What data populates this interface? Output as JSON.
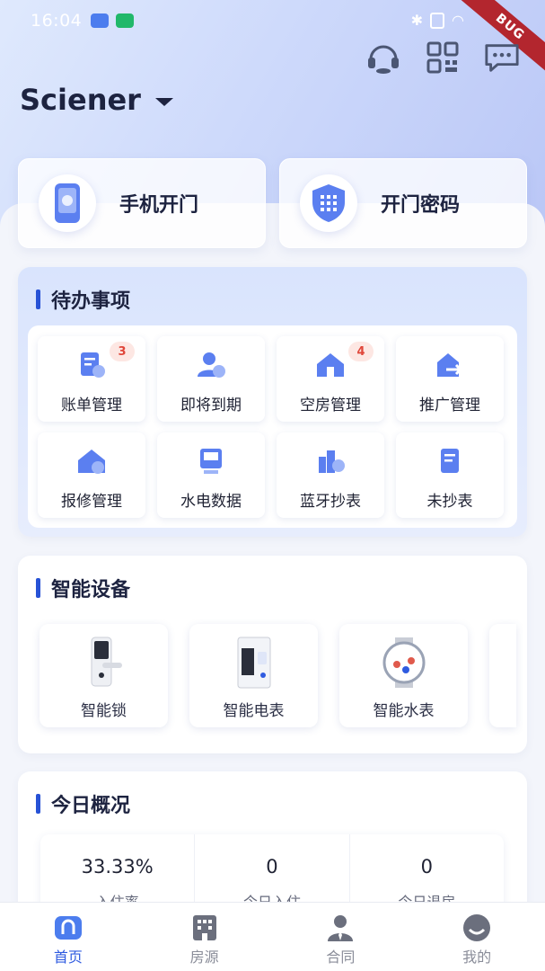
{
  "status_bar": {
    "time": "16:04"
  },
  "debug_banner": "BUG",
  "header": {
    "org_name": "Sciener",
    "icons": [
      "headset-icon",
      "qrcode-icon",
      "message-icon"
    ]
  },
  "quick_actions": [
    {
      "label": "手机开门",
      "icon": "phone-door-icon"
    },
    {
      "label": "开门密码",
      "icon": "password-shield-icon"
    }
  ],
  "todo": {
    "title": "待办事项",
    "items": [
      {
        "label": "账单管理",
        "badge": "3",
        "icon": "bill-icon"
      },
      {
        "label": "即将到期",
        "badge": "",
        "icon": "expiring-user-icon"
      },
      {
        "label": "空房管理",
        "badge": "4",
        "icon": "vacant-house-icon"
      },
      {
        "label": "推广管理",
        "badge": "",
        "icon": "promotion-icon"
      },
      {
        "label": "报修管理",
        "badge": "",
        "icon": "repair-house-icon"
      },
      {
        "label": "水电数据",
        "badge": "",
        "icon": "utility-data-icon"
      },
      {
        "label": "蓝牙抄表",
        "badge": "",
        "icon": "bluetooth-meter-icon"
      },
      {
        "label": "未抄表",
        "badge": "",
        "icon": "unread-meter-icon"
      }
    ]
  },
  "devices": {
    "title": "智能设备",
    "items": [
      {
        "label": "智能锁",
        "icon": "smart-lock-icon"
      },
      {
        "label": "智能电表",
        "icon": "electric-meter-icon"
      },
      {
        "label": "智能水表",
        "icon": "water-meter-icon"
      }
    ]
  },
  "today": {
    "title": "今日概况",
    "stats": [
      {
        "value": "33.33%",
        "label": "入住率"
      },
      {
        "value": "0",
        "label": "今日入住"
      },
      {
        "value": "0",
        "label": "今日退房"
      }
    ]
  },
  "tabbar": {
    "tabs": [
      {
        "label": "首页",
        "icon": "home-icon",
        "active": true
      },
      {
        "label": "房源",
        "icon": "building-icon",
        "active": false
      },
      {
        "label": "合同",
        "icon": "contract-person-icon",
        "active": false
      },
      {
        "label": "我的",
        "icon": "profile-icon",
        "active": false
      }
    ]
  },
  "colors": {
    "accent": "#2f5be0",
    "badge_bg": "#fde7e3",
    "badge_text": "#e0463a"
  }
}
